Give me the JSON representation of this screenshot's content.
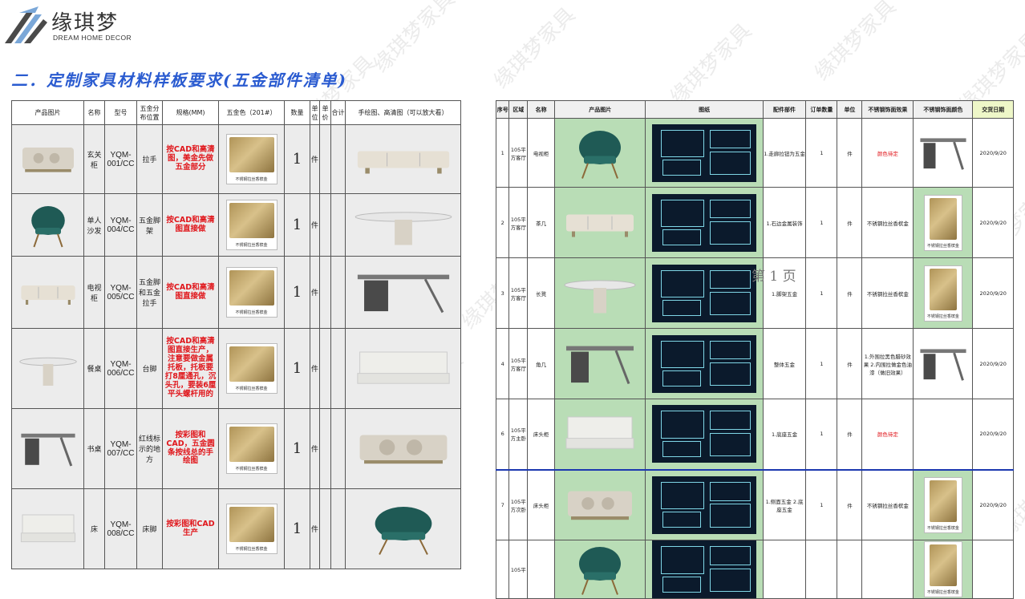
{
  "brand": {
    "name_cn": "缘琪梦",
    "name_en": "DREAM HOME DECOR"
  },
  "page": {
    "title": "二．定制家具材料样板要求(五金部件清单)",
    "page_number": "第 1 页",
    "watermark": "缘琪梦家具"
  },
  "left_table": {
    "headers": [
      "产品图片",
      "名称",
      "型号",
      "五金分布位置",
      "规格(MM)",
      "五金色（201#）",
      "数量",
      "单位",
      "单价",
      "合计",
      "手绘图、高清图（可以放大看）"
    ],
    "swatch_caption": "不锈钢拉丝香槟金",
    "swatch_code": "201#",
    "rows": [
      {
        "name": "玄关柜",
        "model": "YQM-001/CC",
        "position": "拉手",
        "spec": "按CAD和高清图，美金先做五金部分",
        "qty": "1",
        "unit": "件"
      },
      {
        "name": "单人沙发",
        "model": "YQM-004/CC",
        "position": "五金脚架",
        "spec": "按CAD和高清图直接做",
        "qty": "1",
        "unit": "件"
      },
      {
        "name": "电视柜",
        "model": "YQM-005/CC",
        "position": "五金脚和五金拉手",
        "spec": "按CAD和高清图直接做",
        "qty": "1",
        "unit": "件"
      },
      {
        "name": "餐桌",
        "model": "YQM-006/CC",
        "position": "台脚",
        "spec": "按CAD和高清图直接生产，注意要做金属托板，托板要打8厘通孔，沉头孔，要装6厘平头螺杆用的",
        "qty": "1",
        "unit": "件"
      },
      {
        "name": "书桌",
        "model": "YQM-007/CC",
        "position": "红线标示的地方",
        "spec": "按彩图和CAD，五金圆条按线总的手绘图",
        "qty": "1",
        "unit": "件"
      },
      {
        "name": "床",
        "model": "YQM-008/CC",
        "position": "床脚",
        "spec": "按彩图和CAD生产",
        "qty": "1",
        "unit": "件"
      }
    ]
  },
  "right_table": {
    "headers": [
      "序号",
      "区域",
      "名称",
      "产品图片",
      "图纸",
      "配件部件",
      "订单数量",
      "单位",
      "不锈钢饰面效果",
      "不锈钢饰面颜色",
      "交货日期"
    ],
    "swatch_caption": "不锈钢拉丝香槟金",
    "rows": [
      {
        "no": "1",
        "area": "105平方客厅",
        "name": "电视柜",
        "parts": "1.走廊拉钮为五金",
        "qty": "1",
        "unit": "件",
        "effect": "颜色待定",
        "effect_red": true,
        "swatch": "photo",
        "date": "2020/9/20"
      },
      {
        "no": "2",
        "area": "105平方客厅",
        "name": "茶几",
        "parts": "1.石边金属装饰",
        "qty": "1",
        "unit": "件",
        "effect": "不锈钢拉丝香槟金",
        "effect_red": false,
        "swatch": "card",
        "date": "2020/9/20"
      },
      {
        "no": "3",
        "area": "105平方客厅",
        "name": "长凳",
        "parts": "1.脚架五金",
        "qty": "1",
        "unit": "件",
        "effect": "不锈钢拉丝香槟金",
        "effect_red": false,
        "swatch": "card",
        "date": "2020/9/20"
      },
      {
        "no": "4",
        "area": "105平方客厅",
        "name": "角几",
        "parts": "整体五金",
        "qty": "1",
        "unit": "件",
        "effect": "1.外围拉黑色腊砂效果 2.内围拉做金色油漆（做旧效果）",
        "effect_red": false,
        "swatch": "photo",
        "date": "2020/9/20"
      },
      {
        "no": "6",
        "area": "105平方主卧",
        "name": "床头柜",
        "parts": "1.底座五金",
        "qty": "1",
        "unit": "件",
        "effect": "颜色待定",
        "effect_red": true,
        "swatch": "none",
        "date": "2020/9/20"
      },
      {
        "no": "7",
        "area": "105平方次卧",
        "name": "床头柜",
        "parts": "1.侧面五金 2.底座五金",
        "qty": "1",
        "unit": "件",
        "effect": "不锈钢拉丝香槟金",
        "effect_red": false,
        "swatch": "card",
        "date": "2020/9/20"
      },
      {
        "no": "",
        "area": "105平",
        "name": "",
        "parts": "",
        "qty": "",
        "unit": "",
        "effect": "",
        "effect_red": false,
        "swatch": "card",
        "date": ""
      }
    ]
  },
  "colors": {
    "title": "#2A5BD0",
    "emphasis": "#E0161B",
    "green_cell": "#B9DDB6",
    "selection": "#1C38B0"
  }
}
